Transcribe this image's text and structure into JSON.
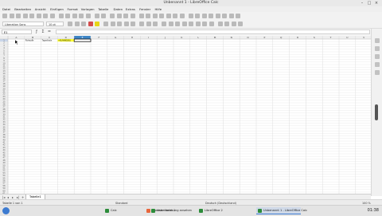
{
  "window": {
    "title": "Unbenannt 1 - LibreOffice Calc"
  },
  "menubar": {
    "items": [
      "Datei",
      "Bearbeiten",
      "Ansicht",
      "Einfügen",
      "Format",
      "Vorlagen",
      "Tabelle",
      "Daten",
      "Extras",
      "Fenster",
      "Hilfe"
    ]
  },
  "toolbar2": {
    "font_name": "Liberation Sans",
    "font_size": "10 pt"
  },
  "formula_bar": {
    "cell_ref": "E1",
    "content": ""
  },
  "grid": {
    "columns": [
      "A",
      "B",
      "C",
      "D",
      "E",
      "F",
      "G",
      "H",
      "I",
      "J",
      "K",
      "L",
      "M",
      "N",
      "O",
      "P",
      "Q",
      "R",
      "S",
      "T",
      "U",
      "V"
    ],
    "row_count": 61,
    "selected_column": "E",
    "selected_row": 1,
    "cells": [
      {
        "col": "B",
        "row": 1,
        "text": "Rohstoffe"
      },
      {
        "col": "C",
        "row": 1,
        "text": "Tagesfinale"
      },
      {
        "col": "D",
        "row": 1,
        "text": "=SUMME(B1)",
        "bg": "#ffff33"
      }
    ]
  },
  "sheet_tabs": [
    "Tabelle1"
  ],
  "statusbar": {
    "sheet": "Tabelle 1 von 1",
    "style": "Standard",
    "language": "Deutsch (Deutschland)",
    "zoom": "100 %"
  },
  "taskbar": {
    "items": [
      {
        "label": "Browser Vorlesung ansehen",
        "color": "#e8663c"
      },
      {
        "label": "Calc",
        "color": "#2c8c3a"
      },
      {
        "label": "Unbenannt 1",
        "color": "#2c8c3a"
      },
      {
        "label": "LibreOffice 2",
        "color": "#2c8c3a"
      },
      {
        "label": "Unbenannt 1 - LibreOffice Calc",
        "color": "#2c8c3a",
        "active": true
      }
    ],
    "clock": "01:38"
  },
  "colors": {
    "accent": "#3d7bd0",
    "selected_col_header": "#3d85c6"
  }
}
